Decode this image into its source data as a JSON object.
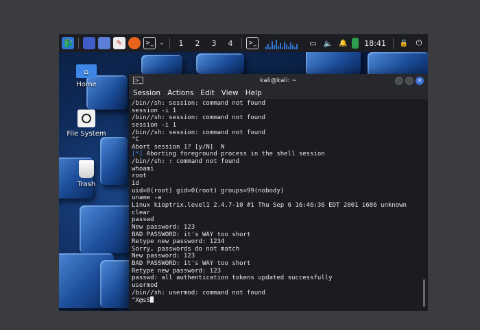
{
  "taskbar": {
    "workspaces": [
      "1",
      "2",
      "3",
      "4"
    ],
    "clock": "18:41",
    "icons": [
      "kali-menu-icon",
      "show-desktop-icon",
      "file-manager-icon",
      "text-editor-icon",
      "firefox-icon",
      "terminal-icon",
      "chevron-down-icon",
      "terminal-app-icon",
      "display-icon",
      "volume-icon",
      "notification-bell-icon",
      "battery-icon",
      "lock-icon",
      "power-icon"
    ]
  },
  "desktop": {
    "icons": [
      {
        "label": "Home",
        "icon": "home-folder-icon"
      },
      {
        "label": "File System",
        "icon": "drive-icon"
      },
      {
        "label": "Trash",
        "icon": "trash-icon"
      }
    ]
  },
  "terminal": {
    "title": "kali@kali: ~",
    "menu": [
      "Session",
      "Actions",
      "Edit",
      "View",
      "Help"
    ],
    "lines": [
      "/bin//sh: session: command not found",
      "session -i 1",
      "/bin//sh: session: command not found",
      "session -i 1",
      "/bin//sh: session: command not found",
      "^C",
      "Abort session 1? [y/N]  N",
      "[*] Aborting foreground process in the shell session",
      "/bin//sh: : command not found",
      "whoami",
      "root",
      "id",
      "uid=0(root) gid=0(root) groups=99(nobody)",
      "uname -a",
      "Linux kioptrix.level1 2.4.7-10 #1 Thu Sep 6 16:46:36 EDT 2001 i686 unknown",
      "clear",
      "passwd",
      "New password: 123",
      "BAD PASSWORD: it's WAY too short",
      "Retype new password: 1234",
      "Sorry, passwords do not match",
      "New password: 123",
      "BAD PASSWORD: it's WAY too short",
      "Retype new password: 123",
      "passwd: all authentication tokens updated successfully",
      "usermod",
      "/bin//sh: usermod: command not found",
      "^X@sS"
    ],
    "info_marker": "[*]",
    "info_rest": " Aborting foreground process in the shell session",
    "accent": "#3c8cff"
  }
}
